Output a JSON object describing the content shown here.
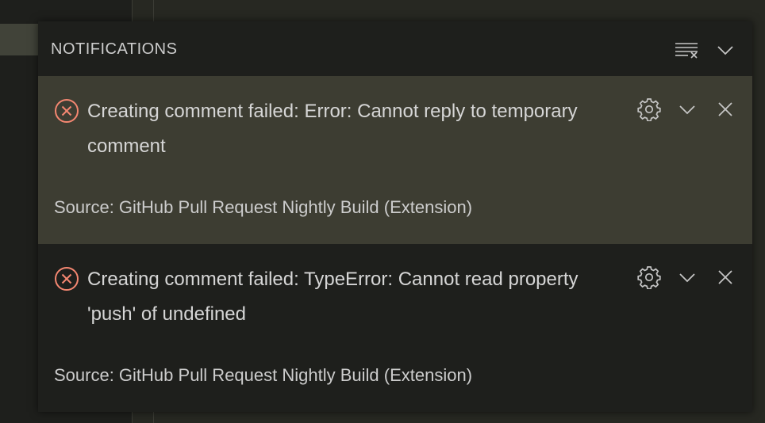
{
  "notifications_center": {
    "title": "NOTIFICATIONS",
    "header_actions": {
      "clear_all_icon": "clear-all-icon",
      "collapse_icon": "chevron-down-icon"
    },
    "items": [
      {
        "severity": "error",
        "message": "Creating comment failed: Error: Cannot reply to temporary comment",
        "source": "Source: GitHub Pull Request Nightly Build (Extension)",
        "focused": true
      },
      {
        "severity": "error",
        "message": "Creating comment failed: TypeError: Cannot read property 'push' of undefined",
        "source": "Source: GitHub Pull Request Nightly Build (Extension)",
        "focused": false
      }
    ]
  },
  "colors": {
    "error": "#f48771",
    "focused_background": "#3d3d32",
    "panel_background": "#1e1f1c",
    "text": "#cccccc"
  }
}
